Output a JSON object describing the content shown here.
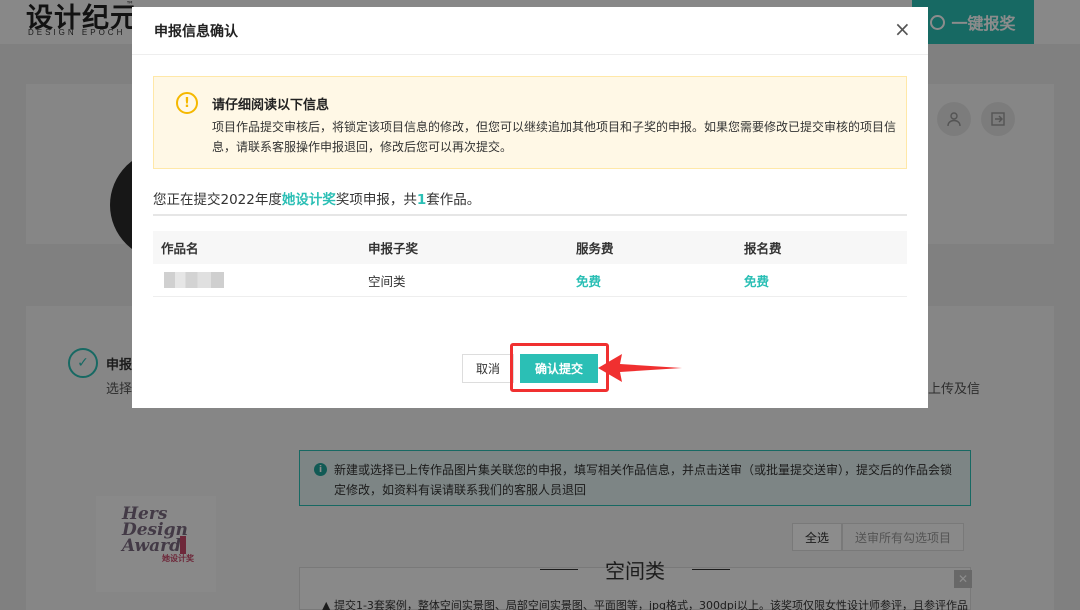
{
  "background": {
    "logo": {
      "text": "设计纪元",
      "tm": "™",
      "sub": "DESIGN EPOCH"
    },
    "one_click_button": "一键报奖",
    "section": {
      "heading": "申报",
      "sub": "选择",
      "right_text": "上传及信"
    },
    "award_logo": {
      "lines": [
        "Hers",
        "Design",
        "Award"
      ],
      "cn": "她设计奖"
    },
    "notice": "新建或选择已上传作品图片集关联您的申报，填写相关作品信息，并点击送审（或批量提交送审），提交后的作品会锁定修改，如资料有误请联系我们的客服人员退回",
    "select_all": "全选",
    "batch_submit": "送审所有勾选项目",
    "category": "空间类",
    "bottom_text": "▲ 提交1-3套案例，整体空间实景图、局部空间实景图、平面图等，jpg格式，300dpi以上。该奖项仅限女性设计师参评，且参评作品"
  },
  "modal": {
    "title": "申报信息确认",
    "close": "×",
    "warning": {
      "title": "请仔细阅读以下信息",
      "text": "项目作品提交审核后，将锁定该项目信息的修改，但您可以继续追加其他项目和子奖的申报。如果您需要修改已提交审核的项目信息，请联系客服操作申报退回，修改后您可以再次提交。"
    },
    "summary": {
      "prefix": "您正在提交2022年度",
      "award": "她设计奖",
      "middle": "奖项申报，共",
      "count": "1",
      "suffix": "套作品。"
    },
    "table": {
      "headers": [
        "作品名",
        "申报子奖",
        "服务费",
        "报名费"
      ],
      "rows": [
        {
          "name": "",
          "sub_award": "空间类",
          "service_fee": "免费",
          "entry_fee": "免费"
        }
      ]
    },
    "cancel_label": "取消",
    "confirm_label": "确认提交"
  },
  "colors": {
    "accent": "#2bbfb5",
    "warning_bg": "#fff8e6",
    "warning_icon": "#f5b800",
    "annotation_red": "#f03030"
  }
}
